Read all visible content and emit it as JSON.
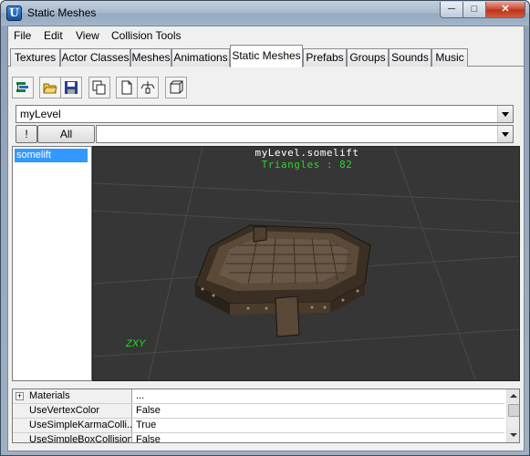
{
  "window": {
    "title": "Static Meshes",
    "minimize": "─",
    "maximize": "□",
    "close": "✕",
    "app_icon": "U"
  },
  "menu": [
    "File",
    "Edit",
    "View",
    "Collision Tools"
  ],
  "tabs": [
    "Textures",
    "Actor Classes",
    "Meshes",
    "Animations",
    "Static Meshes",
    "Prefabs",
    "Groups",
    "Sounds",
    "Music"
  ],
  "active_tab": "Static Meshes",
  "toolbar": [
    "browser-icon",
    "open-folder-icon",
    "save-icon",
    "duplicate-icon",
    "new-document-icon",
    "add-to-level-icon",
    "collision-box-icon"
  ],
  "package_combo": {
    "value": "myLevel"
  },
  "filter": {
    "bang_label": "!",
    "all_label": "All",
    "group_value": ""
  },
  "list": {
    "items": [
      "somelift"
    ],
    "selected": "somelift"
  },
  "viewport": {
    "mesh_name": "myLevel.somelift",
    "triangles_text": "Triangles : 82",
    "axis_label": "ZXY",
    "background_color": "#363636",
    "label_color": "#2fd12f"
  },
  "properties": [
    {
      "name": "Materials",
      "value": "...",
      "expandable": true
    },
    {
      "name": "UseVertexColor",
      "value": "False"
    },
    {
      "name": "UseSimpleKarmaColli...",
      "value": "True"
    },
    {
      "name": "UseSimpleBoxCollision",
      "value": "False"
    }
  ]
}
